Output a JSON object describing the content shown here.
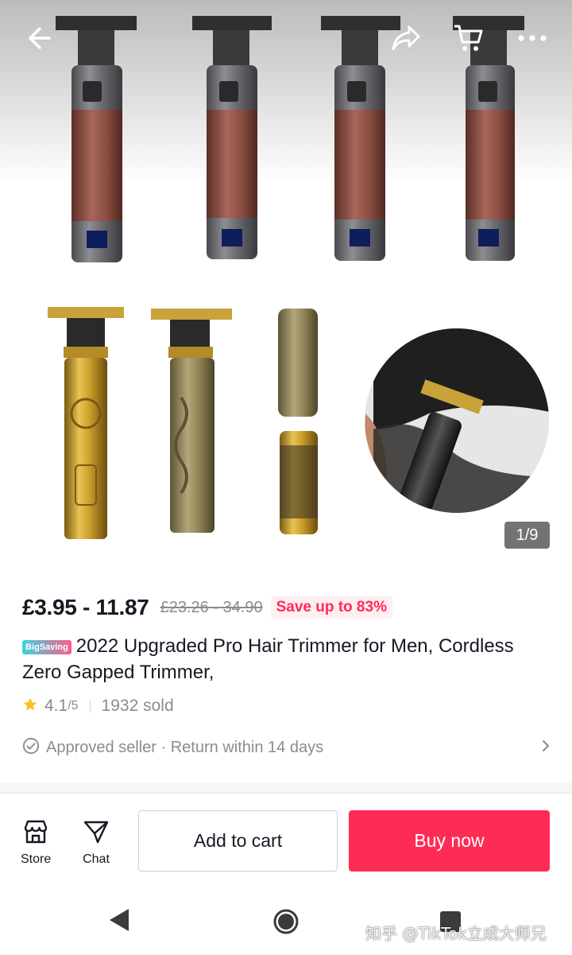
{
  "gallery": {
    "counter": "1/9"
  },
  "nav": {
    "icons": [
      "back-arrow-icon",
      "share-icon",
      "cart-icon",
      "more-icon"
    ]
  },
  "product": {
    "price": "£3.95 - 11.87",
    "original_price": "£23.26 - 34.90",
    "save_label": "Save up to 83%",
    "badge": "BigSaving",
    "title": "2022 Upgraded Pro Hair Trimmer for Men, Cordless Zero Gapped Trimmer,",
    "rating": "4.1",
    "rating_max": "/5",
    "sold": "1932 sold",
    "seller_info": "Approved seller · Return within 14 days"
  },
  "actions": {
    "store_label": "Store",
    "chat_label": "Chat",
    "add_to_cart_label": "Add to cart",
    "buy_now_label": "Buy now"
  },
  "watermark": "知乎 @TikTok立成大师兄",
  "colors": {
    "accent": "#fe2c55",
    "text_primary": "#161823",
    "text_secondary": "#8a8b91",
    "star": "#f7c21a"
  }
}
